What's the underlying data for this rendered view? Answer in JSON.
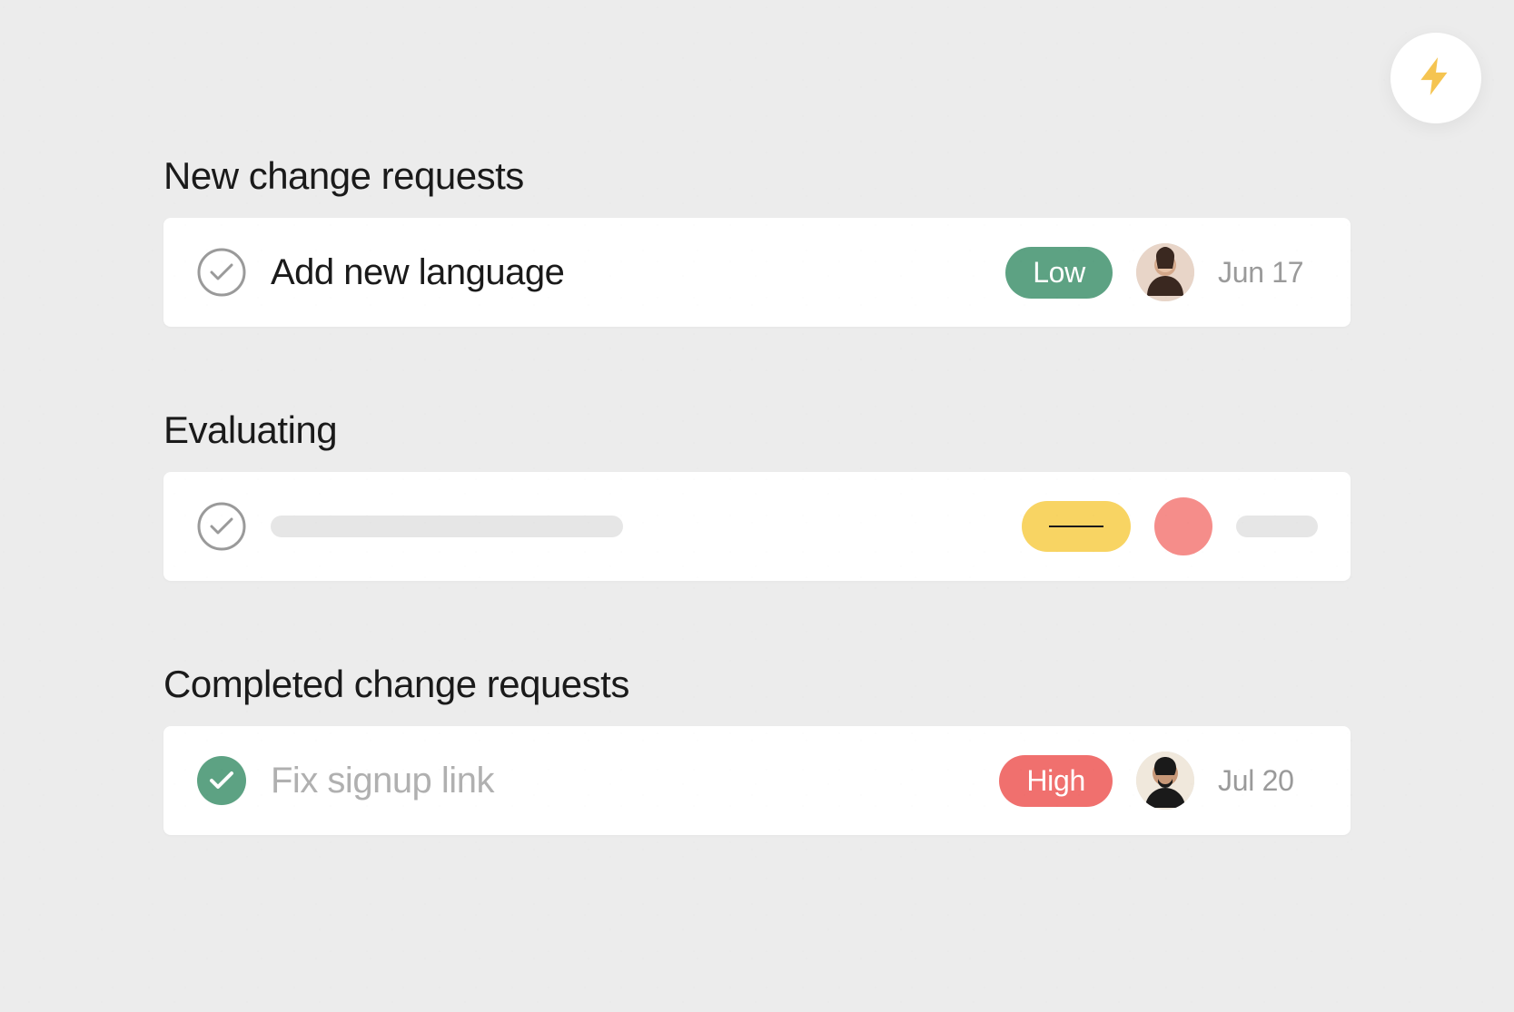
{
  "sections": [
    {
      "title": "New change requests",
      "type": "task",
      "task": {
        "completed": false,
        "title": "Add new language",
        "priority": {
          "label": "Low",
          "level": "low"
        },
        "assignee": "avatar-1",
        "date": "Jun 17"
      }
    },
    {
      "title": "Evaluating",
      "type": "placeholder"
    },
    {
      "title": "Completed change requests",
      "type": "task",
      "task": {
        "completed": true,
        "title": "Fix signup link",
        "priority": {
          "label": "High",
          "level": "high"
        },
        "assignee": "avatar-2",
        "date": "Jul 20"
      }
    }
  ],
  "colors": {
    "low": "#5da283",
    "high": "#f0706e",
    "yellow": "#f8d463",
    "avatar_placeholder": "#f58d8a",
    "lightning": "#f5c451"
  }
}
